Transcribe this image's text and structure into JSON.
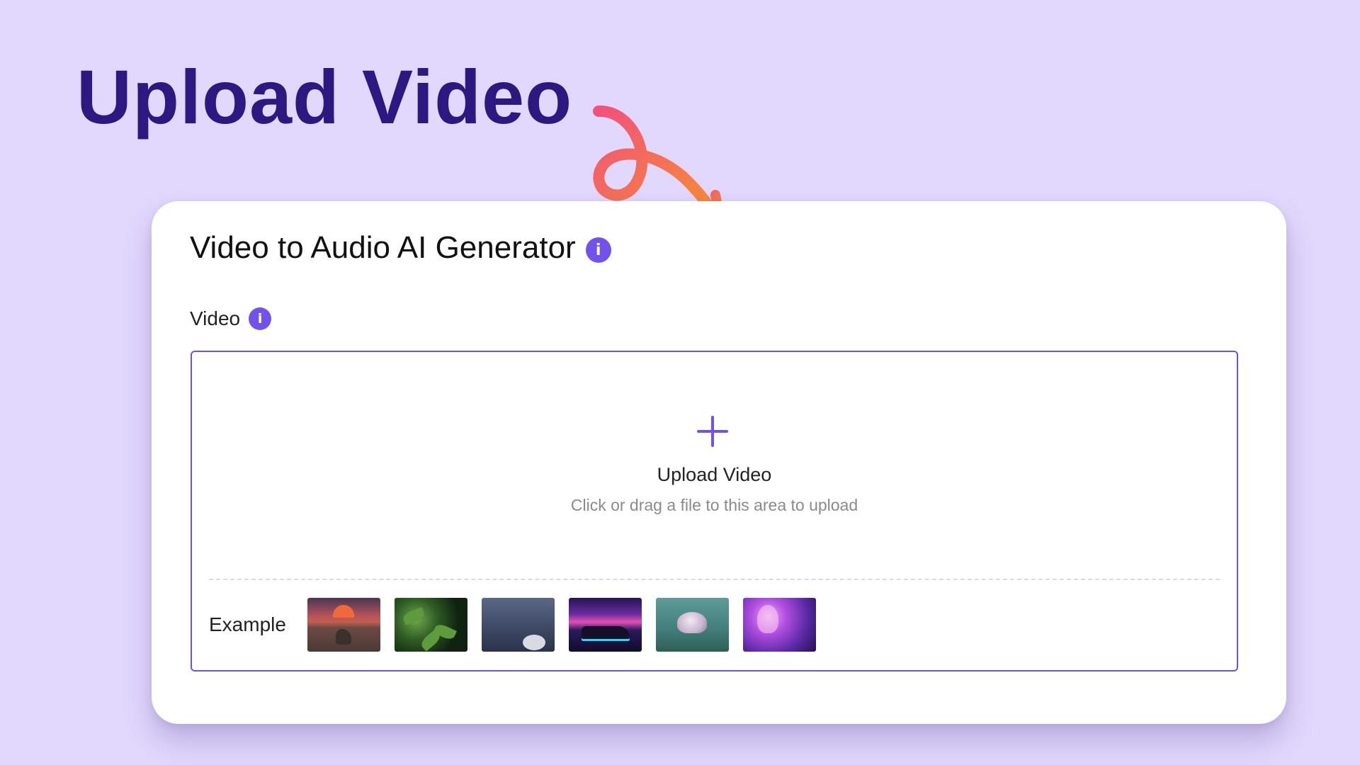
{
  "hero": {
    "title": "Upload Video"
  },
  "card": {
    "title": "Video to Audio AI Generator",
    "info_icon": "info-icon",
    "field": {
      "label": "Video",
      "info_icon": "info-icon"
    },
    "dropzone": {
      "icon": "plus-icon",
      "title": "Upload Video",
      "hint": "Click or drag a file to this area to upload"
    },
    "examples": {
      "label": "Example",
      "thumbnails": [
        "sunset-wolf-thumbnail",
        "green-leaves-thumbnail",
        "drummer-stage-thumbnail",
        "neon-car-thumbnail",
        "jellyfish-thumbnail",
        "glowing-figure-thumbnail"
      ]
    }
  },
  "colors": {
    "background": "#e2d7fd",
    "hero_text": "#2d1780",
    "accent": "#7352ec",
    "arrow_start": "#f0527a",
    "arrow_end": "#f7922f"
  }
}
